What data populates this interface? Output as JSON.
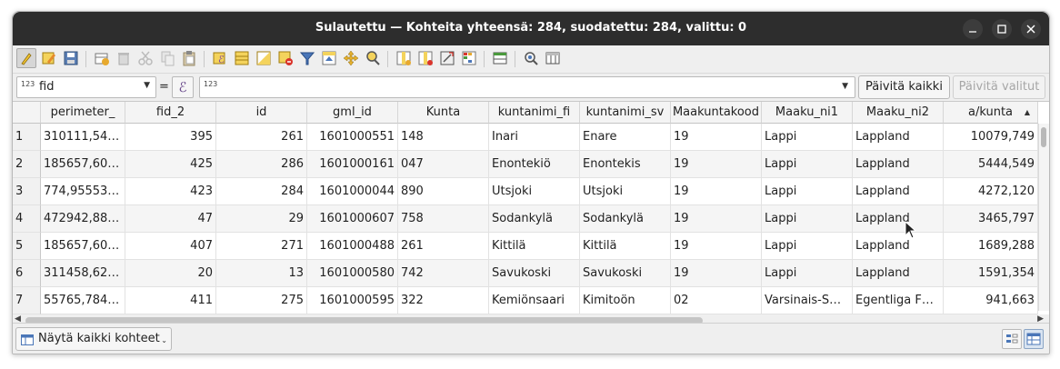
{
  "window": {
    "title": "Sulautettu — Kohteita yhteensä: 284, suodatettu: 284, valittu: 0",
    "controls": [
      "minimize-icon",
      "maximize-icon",
      "close-icon"
    ]
  },
  "toolbar": {
    "icons": [
      "toggle-editing-icon",
      "multi-edit-icon",
      "save-edits-icon",
      "add-feature-icon",
      "delete-feature-icon",
      "cut-icon",
      "copy-icon",
      "paste-icon",
      "select-by-expression-icon",
      "select-all-icon",
      "invert-selection-icon",
      "deselect-all-icon",
      "filter-select-icon",
      "move-selection-to-top-icon",
      "pan-to-selected-icon",
      "zoom-to-selected-icon",
      "new-field-icon",
      "delete-field-icon",
      "field-calculator-icon",
      "conditional-formatting-icon",
      "dock-table-icon",
      "actions-icon",
      "organize-columns-icon"
    ]
  },
  "expression_bar": {
    "field_type": "123",
    "field_name": "fid",
    "equals": "=",
    "epsilon": "ℰ",
    "expression_type": "123",
    "expression_value": "",
    "update_all_label": "Päivitä kaikki",
    "update_selected_label": "Päivitä valitut"
  },
  "table": {
    "columns": [
      "perimeter_",
      "fid_2",
      "id",
      "gml_id",
      "Kunta",
      "kuntanimi_fi",
      "kuntanimi_sv",
      "Maakuntakood",
      "Maaku_ni1",
      "Maaku_ni2",
      "a/kunta"
    ],
    "sorted_column_indicator": "▲",
    "rows": [
      [
        "1",
        "310111,54…",
        "395",
        "261",
        "1601000551",
        "148",
        "Inari",
        "Enare",
        "19",
        "Lappi",
        "Lappland",
        "10079,749"
      ],
      [
        "2",
        "185657,60…",
        "425",
        "286",
        "1601000161",
        "047",
        "Enontekiö",
        "Enontekis",
        "19",
        "Lappi",
        "Lappland",
        "5444,549"
      ],
      [
        "3",
        "774,95553…",
        "423",
        "284",
        "1601000044",
        "890",
        "Utsjoki",
        "Utsjoki",
        "19",
        "Lappi",
        "Lappland",
        "4272,120"
      ],
      [
        "4",
        "472942,88…",
        "47",
        "29",
        "1601000607",
        "758",
        "Sodankylä",
        "Sodankylä",
        "19",
        "Lappi",
        "Lappland",
        "3465,797"
      ],
      [
        "5",
        "185657,60…",
        "407",
        "271",
        "1601000488",
        "261",
        "Kittilä",
        "Kittilä",
        "19",
        "Lappi",
        "Lappland",
        "1689,288"
      ],
      [
        "6",
        "311458,62…",
        "20",
        "13",
        "1601000580",
        "742",
        "Savukoski",
        "Savukoski",
        "19",
        "Lappi",
        "Lappland",
        "1591,354"
      ],
      [
        "7",
        "55765,784…",
        "411",
        "275",
        "1601000595",
        "322",
        "Kemiönsaari",
        "Kimitoön",
        "02",
        "Varsinais-S…",
        "Egentliga F…",
        "941,663"
      ]
    ]
  },
  "statusbar": {
    "show_all_label": "Näytä kaikki kohteet",
    "dropdown_glyph": "⌄"
  },
  "colors": {
    "titlebar": "#2d2d2d",
    "panel": "#efefef",
    "row_alt": "#f5f5f5"
  }
}
